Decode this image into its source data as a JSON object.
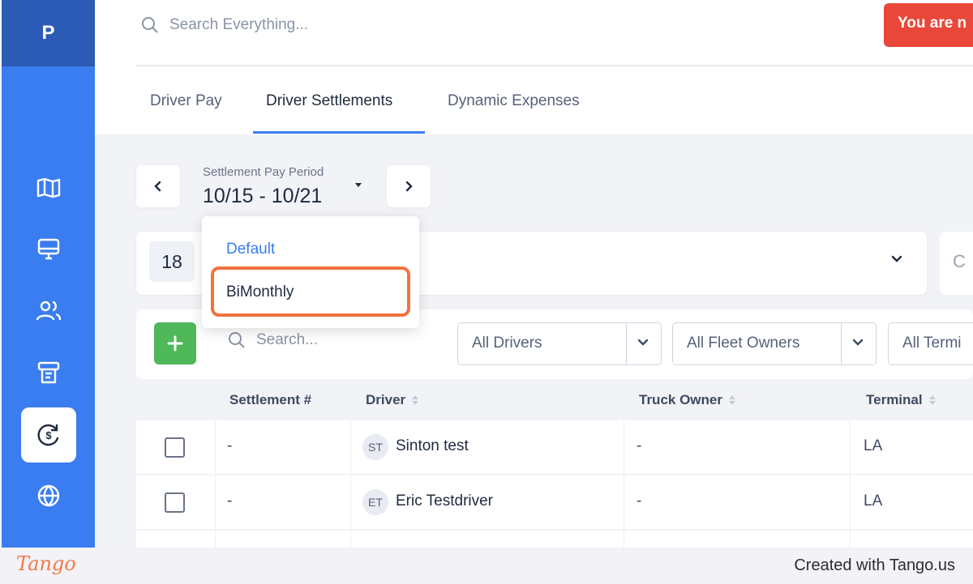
{
  "app": {
    "logo_text": "P"
  },
  "sidebar": {
    "items": [
      {
        "icon": "map-icon"
      },
      {
        "icon": "monitor-icon"
      },
      {
        "icon": "users-icon"
      },
      {
        "icon": "receipt-icon"
      },
      {
        "icon": "dollar-cycle-icon",
        "active": true
      },
      {
        "icon": "globe-icon"
      }
    ]
  },
  "header": {
    "search_placeholder": "Search Everything...",
    "alert_text": "You are n"
  },
  "tabs": [
    {
      "label": "Driver Pay"
    },
    {
      "label": "Driver Settlements",
      "active": true
    },
    {
      "label": "Dynamic Expenses"
    }
  ],
  "pay_period": {
    "label": "Settlement Pay Period",
    "value": "10/15 - 10/21",
    "options": [
      "Default",
      "BiMonthly"
    ],
    "highlighted_option": "BiMonthly"
  },
  "filters": {
    "count": "18",
    "partial_card_text": "C"
  },
  "toolbar": {
    "search_placeholder": "Search...",
    "drivers_select": "All Drivers",
    "fleet_owners_select": "All Fleet Owners",
    "terminals_select": "All Termi"
  },
  "table": {
    "columns": [
      "Settlement #",
      "Driver",
      "Truck Owner",
      "Terminal"
    ],
    "rows": [
      {
        "settlement": "-",
        "initials": "ST",
        "driver": "Sinton test",
        "truck_owner": "-",
        "terminal": "LA"
      },
      {
        "settlement": "-",
        "initials": "ET",
        "driver": "Eric Testdriver",
        "truck_owner": "-",
        "terminal": "LA"
      }
    ]
  },
  "footer": {
    "brand": "Tango",
    "credit": "Created with Tango.us"
  },
  "colors": {
    "sidebar": "#3a7df0",
    "sidebar_logo_bg": "#2c5bb5",
    "accent": "#3a7df0",
    "alert": "#e8473a",
    "add_button": "#4fb85a",
    "highlight": "#f0733f"
  }
}
